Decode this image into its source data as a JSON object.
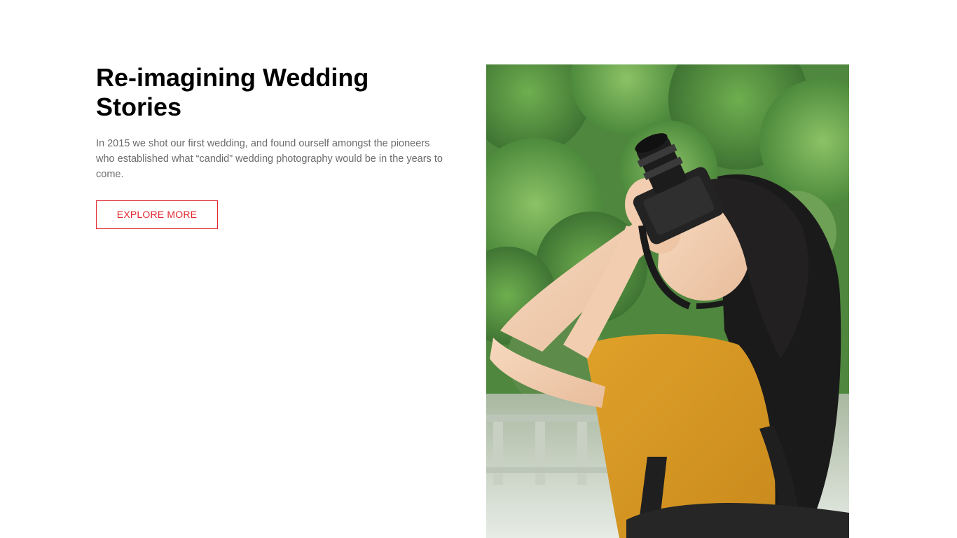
{
  "hero": {
    "title": "Re-imagining Wedding Stories",
    "description": "In 2015 we shot our first wedding, and found ourself amongst the pioneers who established what “candid” wedding photography would be in the years to come.",
    "cta_label": "EXPLORE MORE",
    "image_icon": "photo-woman-with-camera"
  },
  "colors": {
    "accent": "#e0282e",
    "heading": "#000000",
    "body_text": "#6b6b6b",
    "background": "#ffffff",
    "scrollbar_track": "#f1f1f1",
    "scrollbar_thumb": "#c1c1c1"
  }
}
